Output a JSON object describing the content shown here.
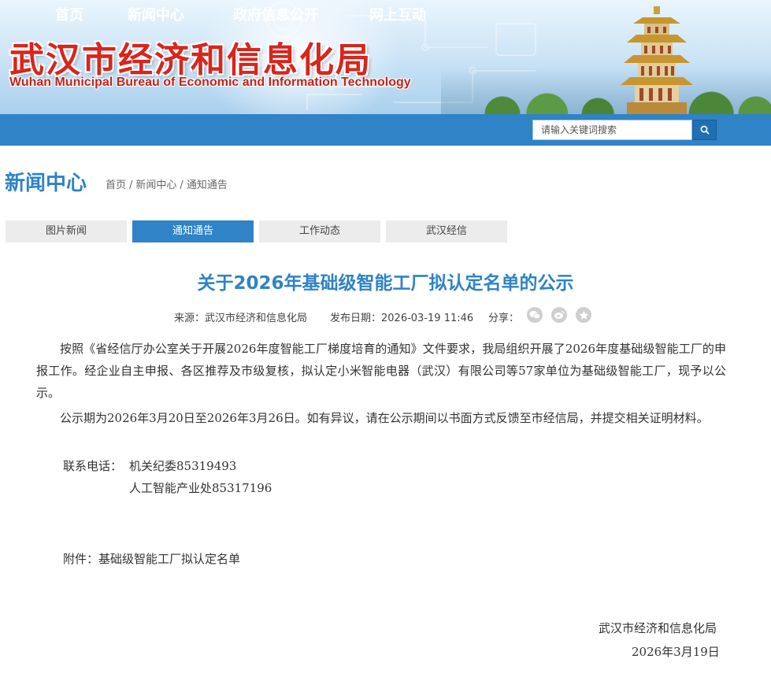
{
  "header": {
    "title_cn": "武汉市经济和信息化局",
    "title_en": "Wuhan Municipal Bureau of Economic and Information Technology"
  },
  "nav": {
    "items": [
      "首页",
      "新闻中心",
      "政府信息公开",
      "网上互动"
    ],
    "search_placeholder": "请输入关键词搜索"
  },
  "section": {
    "title": "新闻中心",
    "breadcrumb": [
      "首页",
      "新闻中心",
      "通知通告"
    ]
  },
  "tabs": [
    {
      "label": "图片新闻",
      "active": false
    },
    {
      "label": "通知通告",
      "active": true
    },
    {
      "label": "工作动态",
      "active": false
    },
    {
      "label": "武汉经信",
      "active": false
    }
  ],
  "article": {
    "title": "关于2026年基础级智能工厂拟认定名单的公示",
    "source_label": "来源：",
    "source": "武汉市经济和信息化局",
    "date_label": "发布日期：",
    "date": "2026-03-19 11:46",
    "share_label": "分享：",
    "share_icons": [
      "wechat-icon",
      "weibo-icon",
      "favorite-icon"
    ],
    "paragraphs": [
      "按照《省经信厅办公室关于开展2026年度智能工厂梯度培育的通知》文件要求，我局组织开展了2026年度基础级智能工厂的申报工作。经企业自主申报、各区推荐及市级复核，拟认定小米智能电器（武汉）有限公司等57家单位为基础级智能工厂，现予以公示。",
      "公示期为2026年3月20日至2026年3月26日。如有异议，请在公示期间以书面方式反馈至市经信局，并提交相关证明材料。"
    ],
    "contact_label": "联系电话：",
    "contacts": [
      "机关纪委85319493",
      "人工智能产业处85317196"
    ],
    "attachment": "附件：基础级智能工厂拟认定名单",
    "signature_org": "武汉市经济和信息化局",
    "signature_date": "2026年3月19日"
  },
  "colors": {
    "brand_blue": "#2f83c6",
    "title_red": "#d9251c"
  }
}
